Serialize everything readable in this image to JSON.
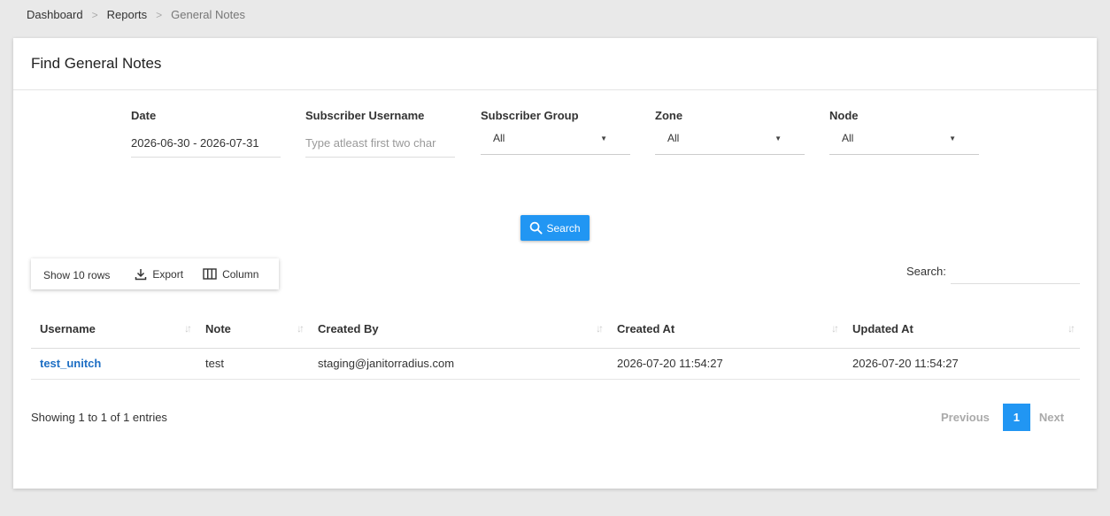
{
  "breadcrumb": [
    "Dashboard",
    "Reports",
    "General Notes"
  ],
  "card": {
    "title": "Find General Notes"
  },
  "filters": {
    "date": {
      "label": "Date",
      "value": "2026-06-30 - 2026-07-31"
    },
    "username": {
      "label": "Subscriber Username",
      "placeholder": "Type atleast first two char"
    },
    "group": {
      "label": "Subscriber Group",
      "value": "All"
    },
    "zone": {
      "label": "Zone",
      "value": "All"
    },
    "node": {
      "label": "Node",
      "value": "All"
    }
  },
  "search_button": "Search",
  "toolbar": {
    "show_rows": "Show 10 rows",
    "export": "Export",
    "column": "Column"
  },
  "table_search_label": "Search:",
  "table": {
    "headers": [
      "Username",
      "Note",
      "Created By",
      "Created At",
      "Updated At"
    ],
    "rows": [
      [
        "test_unitch",
        "test",
        "staging@janitorradius.com",
        "2026-07-20 11:54:27",
        "2026-07-20 11:54:27"
      ]
    ]
  },
  "info": "Showing 1 to 1 of 1 entries",
  "pagination": {
    "previous": "Previous",
    "current": "1",
    "next": "Next"
  },
  "colors": {
    "accent": "#2196f3",
    "link": "#1e6fc4"
  },
  "icons": {
    "search_button": "search-icon",
    "export": "download-icon",
    "column": "columns-icon",
    "select": "caret-down-icon",
    "sort": "sort-icon"
  }
}
